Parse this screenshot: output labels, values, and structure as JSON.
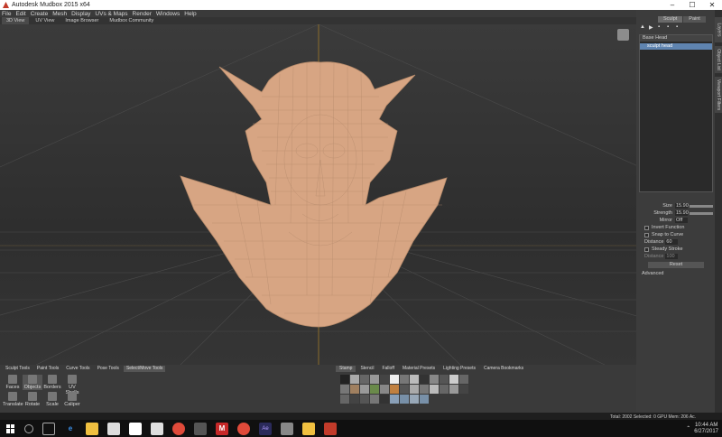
{
  "window": {
    "title": "Autodesk Mudbox 2015 x64",
    "min": "–",
    "max": "☐",
    "close": "✕"
  },
  "menu": [
    "File",
    "Edit",
    "Create",
    "Mesh",
    "Display",
    "UVs & Maps",
    "Render",
    "Windows",
    "Help"
  ],
  "view_tabs": [
    "3D View",
    "UV View",
    "Image Browser",
    "Mudbox Community"
  ],
  "right_panel": {
    "tabs": [
      "Sculpt",
      "Paint"
    ],
    "side_tabs": [
      "Layers",
      "Object List",
      "Viewport Filters"
    ],
    "layer_header": "Base Head",
    "layer_item": "sculpt head",
    "size_label": "Size",
    "size_value": "15.90",
    "strength_label": "Strength",
    "strength_value": "15.90",
    "mirror_label": "Mirror",
    "mirror_value": "Off",
    "invert_label": "Invert Function",
    "snap_label": "Snap to Curve",
    "distance_label": "Distance",
    "distance_value": "60",
    "steady_label": "Steady Stroke",
    "distance2_label": "Distance",
    "distance2_value": "100",
    "reset_label": "Reset",
    "advanced_label": "Advanced"
  },
  "tool_tabs": [
    "Sculpt Tools",
    "Paint Tools",
    "Curve Tools",
    "Pose Tools",
    "Select/Move Tools"
  ],
  "tools": [
    "Faces",
    "Objects",
    "Borders",
    "UV Shells",
    "Translate",
    "Rotate",
    "Scale",
    "Caliper"
  ],
  "stamp_tabs": [
    "Stamp",
    "Stencil",
    "Falloff",
    "Material Presets",
    "Lighting Presets",
    "Camera Bookmarks"
  ],
  "status": "Total: 2002  Selected: 0  GPU Mem: 206  Ac.",
  "clock": {
    "time": "10:44 AM",
    "date": "6/27/2017"
  },
  "colors": {
    "mesh": "#d7a583",
    "accent": "#5f84b0"
  }
}
